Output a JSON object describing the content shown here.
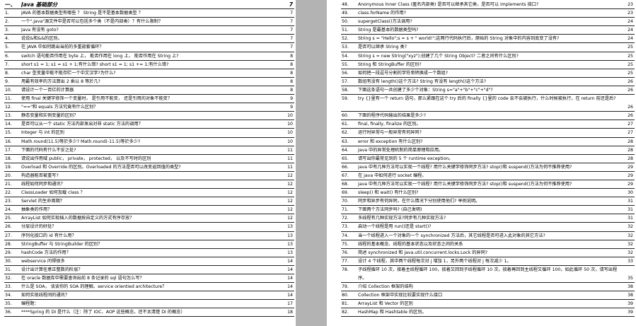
{
  "left_page": {
    "rows": [
      {
        "num": "一、",
        "text": "Java 基础部分",
        "page": "7",
        "section": true
      },
      {
        "num": "1.",
        "text": "JAVA 的基本数据类型有哪些 ？ String 是不是基本数据类型 ？",
        "page": "7"
      },
      {
        "num": "2.",
        "text": "一个\".java\"源文件中是否可以包括多个类（不是内部类）？有什么限制？",
        "page": "7"
      },
      {
        "num": "3.",
        "text": "Java 有没有 goto?",
        "page": "7"
      },
      {
        "num": "4.",
        "text": "说说&和&&的区别。",
        "page": "7"
      },
      {
        "num": "5.",
        "text": "在 JAVA 中如何跳出当前的多重嵌套循环？",
        "page": "7"
      },
      {
        "num": "6.",
        "text": "switch 语句能否作用在 byte 上， 能否作用在 long 上， 能否作用在 String 上?",
        "page": "8"
      },
      {
        "num": "7.",
        "text": "short s1 = 1; s1 = s1 + 1;有什么错? short s1 = 1; s1 += 1;有什么错?",
        "page": "8"
      },
      {
        "num": "8.",
        "text": "char 型变量中能不能存贮一个中文汉字?为什么?",
        "page": "8"
      },
      {
        "num": "9.",
        "text": "用最有效率的方法算出 2 乘以 8 等於几?",
        "page": "8"
      },
      {
        "num": "10.",
        "text": "请设计一个一百亿的计算器",
        "page": "8"
      },
      {
        "num": "11.",
        "text": "使用 final 关键字修饰一个变量时， 是引用不能变， 还是引用的对象不能变？",
        "page": "9"
      },
      {
        "num": "12.",
        "text": "\"==\"和 equals 方法究竟有什么区别？",
        "page": "9"
      },
      {
        "num": "13.",
        "text": "静态变量和实例变量的区别？",
        "page": "10"
      },
      {
        "num": "14.",
        "text": "是否可以从一个 static 方法内部发出对非 static 方法的调用？",
        "page": "10"
      },
      {
        "num": "15.",
        "text": "Integer 与 int 的区别",
        "page": "10"
      },
      {
        "num": "16.",
        "text": "Math.round(11.5)等於多少? Math.round(-11.5)等於多少?",
        "page": "10"
      },
      {
        "num": "17.",
        "text": "下面的代码有什么不妥之处?",
        "page": "11"
      },
      {
        "num": "18.",
        "text": "请说出作用域 public， private， protected， 以及不写时的区别",
        "page": "11"
      },
      {
        "num": "19.",
        "text": "Overload 和 Override 的区别。Overloaded 的方法是否可以改变返回值的类型?",
        "page": "11"
      },
      {
        "num": "20.",
        "text": "构造器能否被重写?",
        "page": "12"
      },
      {
        "num": "21.",
        "text": "线程如何同步和通讯？",
        "page": "12"
      },
      {
        "num": "22.",
        "text": "ClassLoader 如何加载 class ？",
        "page": "12"
      },
      {
        "num": "23.",
        "text": "Servlet 的生命周期？",
        "page": "12"
      },
      {
        "num": "24.",
        "text": "抽象类的作用？",
        "page": "12"
      },
      {
        "num": "25.",
        "text": "ArrayList 如何实现插入的数据按自定义的方式有序存放？",
        "page": "12"
      },
      {
        "num": "26.",
        "text": "分层设计的好处？",
        "page": "13"
      },
      {
        "num": "27.",
        "text": "序列化接口的 id 有什么用？",
        "page": "13"
      },
      {
        "num": "28.",
        "text": "StringBuffer 与 StringBuilder 的区别？",
        "page": "13"
      },
      {
        "num": "29.",
        "text": "hashCode 方法的作用？",
        "page": "13"
      },
      {
        "num": "30.",
        "text": "webservice 问得很多",
        "page": "14"
      },
      {
        "num": "31.",
        "text": "设计出计算任意正整数的阶层？",
        "page": "14"
      },
      {
        "num": "32.",
        "text": "在 oracle 数据库中需要查询出前 8 条记录的 sql 语句怎么写？",
        "page": "14"
      },
      {
        "num": "33.",
        "text": "什么是 SOA， 谈谈你的 SOA 的理解。service orientied architecture？",
        "page": "14"
      },
      {
        "num": "34.",
        "text": "如何实现线程间的通讯？",
        "page": "14"
      },
      {
        "num": "35.",
        "text": "编程题：",
        "page": "17"
      },
      {
        "num": "36.",
        "text": "****Spring 的 DI 是什么（注：除了 IOC、AOP 这些概念，还不太清楚 DI 的概念）",
        "page": "18"
      }
    ]
  },
  "right_page": {
    "rows": [
      {
        "num": "48.",
        "text": "Anonymous Inner Class (匿名内部类) 是否可以继承其它类，是否可以 implements 接口?",
        "page": "23"
      },
      {
        "num": "49.",
        "text": "class.forName 的作用?",
        "page": "23"
      },
      {
        "num": "50.",
        "text": "supergetClass()方法调用?",
        "page": "24"
      },
      {
        "num": "51.",
        "text": "String 是最基本的数据类型吗?",
        "page": "24"
      },
      {
        "num": "52.",
        "text": "String s = \"Hello\";s = s + \" world!\";这两行代码执行后，原始的 String 对象中的内容到底变了没有?",
        "page": "24"
      },
      {
        "num": "53.",
        "text": "是否可以继承 String 类?",
        "page": "25"
      },
      {
        "num": "54.",
        "text": "String s = new String(\"xyz\");创建了几个 String Object? 二者之间有什么区别?",
        "page": "25"
      },
      {
        "num": "55.",
        "text": "String 和 StringBuffer 的区别?",
        "page": "25"
      },
      {
        "num": "56.",
        "text": "如何把一段逗号分割的字符串转换成一个数组?",
        "page": "25"
      },
      {
        "num": "57.",
        "text": "数组有没有 length()这个方法? String 有没有 length()这个方法?",
        "page": "26"
      },
      {
        "num": "58.",
        "text": "下面这条语句一共创建了多少个对象：String s=\"a\"+\"b\"+\"c\"+\"d\"?",
        "page": "26"
      },
      {
        "num": "59.",
        "text": "try {}里有一个 return 语句，那么紧跟在这个 try 后的 finally {}里的 code 会不会被执行，什么时候被执行，在 return 前还是后?",
        "page": "26",
        "tall": true
      },
      {
        "num": "60.",
        "text": "下面的程序代码输出的结果是多少?",
        "page": "26"
      },
      {
        "num": "61.",
        "text": "final, finally, finalize 的区别。",
        "page": "27"
      },
      {
        "num": "62.",
        "text": "运行时异常与一般异常有何异同?",
        "page": "27"
      },
      {
        "num": "63.",
        "text": "error 和 exception 有什么区别?",
        "page": "28"
      },
      {
        "num": "64.",
        "text": "Java 中的异常处理机制的简单原理和应用。",
        "page": "28"
      },
      {
        "num": "65.",
        "text": "请写出你最常见到的 5 个 runtime exception。",
        "page": "28"
      },
      {
        "num": "66.",
        "text": "java 中有几种方法可以实现一个线程? 用什么关键字修饰同步方法? stop()和 suspend()方法为何不推荐使用?",
        "page": "29"
      },
      {
        "num": "67.",
        "text": "在 java 中如何进行 socket 编程。",
        "page": "29"
      },
      {
        "num": "68.",
        "text": "java 中有几种方法可以实现一个线程? 用什么关键字修饰同步方法? stop()和 suspend()方法为何不推荐使用?",
        "page": "29"
      },
      {
        "num": "69.",
        "text": "sleep() 和 wait() 有什么区别?",
        "page": "30"
      },
      {
        "num": "70.",
        "text": "同步和异步有何异同，在什么情况下分别使用他们? 举例说明。",
        "page": "31"
      },
      {
        "num": "71.",
        "text": "下面两个方法同步吗? (自己发明)",
        "page": "31"
      },
      {
        "num": "72.",
        "text": "多线程有几种实现方法?同步有几种实现方法?",
        "page": "31"
      },
      {
        "num": "73.",
        "text": "启动一个线程是用 run()还是 start()?",
        "page": "32"
      },
      {
        "num": "74.",
        "text": "当一个线程进入一个对象的一个 synchronized 方法后，其它线程是否可进入此对象的其它方法?",
        "page": "32"
      },
      {
        "num": "75.",
        "text": "线程的基本概念、线程的基本状态以及状态之间的关系",
        "page": "32"
      },
      {
        "num": "76.",
        "text": "简述 synchronized 和 java.util.concurrent.locks.Lock 的异同?",
        "page": "32"
      },
      {
        "num": "77.",
        "text": "设计 4 个线程，其中两个线程每次对 j 增加 1，另外两个线程对 j 每次减少 1。",
        "page": "33"
      },
      {
        "num": "78.",
        "text": "子线程循环 10 次，接着主线程循环 100，接着又回到子线程循环 10 次，接着再回到主线程又循环 100，如此循环 50 次，请写出程序。",
        "page": "35",
        "tall": true
      },
      {
        "num": "79.",
        "text": "介绍 Collection 框架的结构",
        "page": "38"
      },
      {
        "num": "80.",
        "text": "Collection 框架中实现比较要实现什么接口",
        "page": "38"
      },
      {
        "num": "81.",
        "text": "ArrayList 和 Vector 的区别",
        "page": "39"
      },
      {
        "num": "82.",
        "text": "HashMap 和 Hashtable 的区别。",
        "page": "39"
      }
    ]
  }
}
